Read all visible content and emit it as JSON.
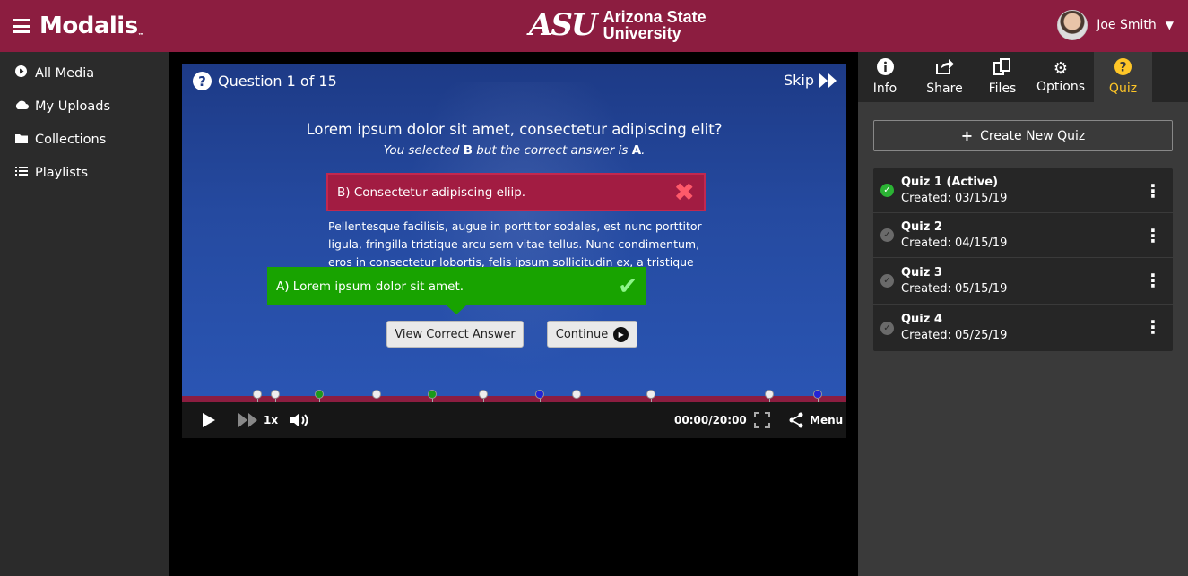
{
  "header": {
    "brand": "Modalis",
    "brand_tm": "™",
    "university_logo": "ASU",
    "university_line1": "Arizona State",
    "university_line2": "University",
    "user_name": "Joe Smith"
  },
  "sidebar": {
    "items": [
      {
        "label": "All Media",
        "icon": "play-circle-icon"
      },
      {
        "label": "My Uploads",
        "icon": "cloud-icon"
      },
      {
        "label": "Collections",
        "icon": "folder-icon"
      },
      {
        "label": "Playlists",
        "icon": "list-icon"
      }
    ]
  },
  "quiz_overlay": {
    "question_counter": "Question 1 of 15",
    "skip_label": "Skip",
    "question": "Lorem ipsum dolor sit amet, consectetur adipiscing elit?",
    "feedback_pre": "You selected ",
    "feedback_selected": "B",
    "feedback_mid": " but the correct answer is ",
    "feedback_correct": "A",
    "feedback_end": ".",
    "wrong_answer": "B) Consectetur adipiscing eliip.",
    "explanation": "Pellentesque facilisis, augue in porttitor sodales, est nunc porttitor ligula, fringilla tristique arcu sem vitae tellus. Nunc condimentum, eros in consectetur lobortis, felis ipsum sollicitudin ex, a tristique",
    "correct_answer": "A) Lorem ipsum dolor sit amet.",
    "view_correct_label": "View Correct Answer",
    "continue_label": "Continue"
  },
  "timeline": {
    "markers": [
      {
        "pos": 0.113,
        "color": "#eeeeee"
      },
      {
        "pos": 0.14,
        "color": "#eeeeee"
      },
      {
        "pos": 0.207,
        "color": "#1a9a1a"
      },
      {
        "pos": 0.293,
        "color": "#eeeeee"
      },
      {
        "pos": 0.376,
        "color": "#1a9a1a"
      },
      {
        "pos": 0.454,
        "color": "#eeeeee"
      },
      {
        "pos": 0.538,
        "color": "#2323d6"
      },
      {
        "pos": 0.594,
        "color": "#eeeeee"
      },
      {
        "pos": 0.706,
        "color": "#eeeeee"
      },
      {
        "pos": 0.884,
        "color": "#eeeeee"
      },
      {
        "pos": 0.957,
        "color": "#2323d6"
      }
    ]
  },
  "controls": {
    "speed": "1x",
    "time": "00:00/20:00",
    "menu_label": "Menu"
  },
  "right_panel": {
    "tabs": [
      {
        "label": "Info",
        "icon": "info-icon",
        "active": false
      },
      {
        "label": "Share",
        "icon": "share-icon",
        "active": false
      },
      {
        "label": "Files",
        "icon": "files-icon",
        "active": false
      },
      {
        "label": "Options",
        "icon": "gear-icon",
        "active": false
      },
      {
        "label": "Quiz",
        "icon": "question-icon",
        "active": true
      }
    ],
    "create_label": "Create New Quiz",
    "quizzes": [
      {
        "title": "Quiz 1 (Active)",
        "created": "Created: 03/15/19",
        "active": true
      },
      {
        "title": "Quiz 2",
        "created": "Created: 04/15/19",
        "active": false
      },
      {
        "title": "Quiz 3",
        "created": "Created: 05/15/19",
        "active": false
      },
      {
        "title": "Quiz 4",
        "created": "Created: 05/25/19",
        "active": false
      }
    ]
  },
  "colors": {
    "brand": "#8c1d40",
    "accent": "#ffc627",
    "correct": "#18a300",
    "wrong": "#a21c42"
  }
}
